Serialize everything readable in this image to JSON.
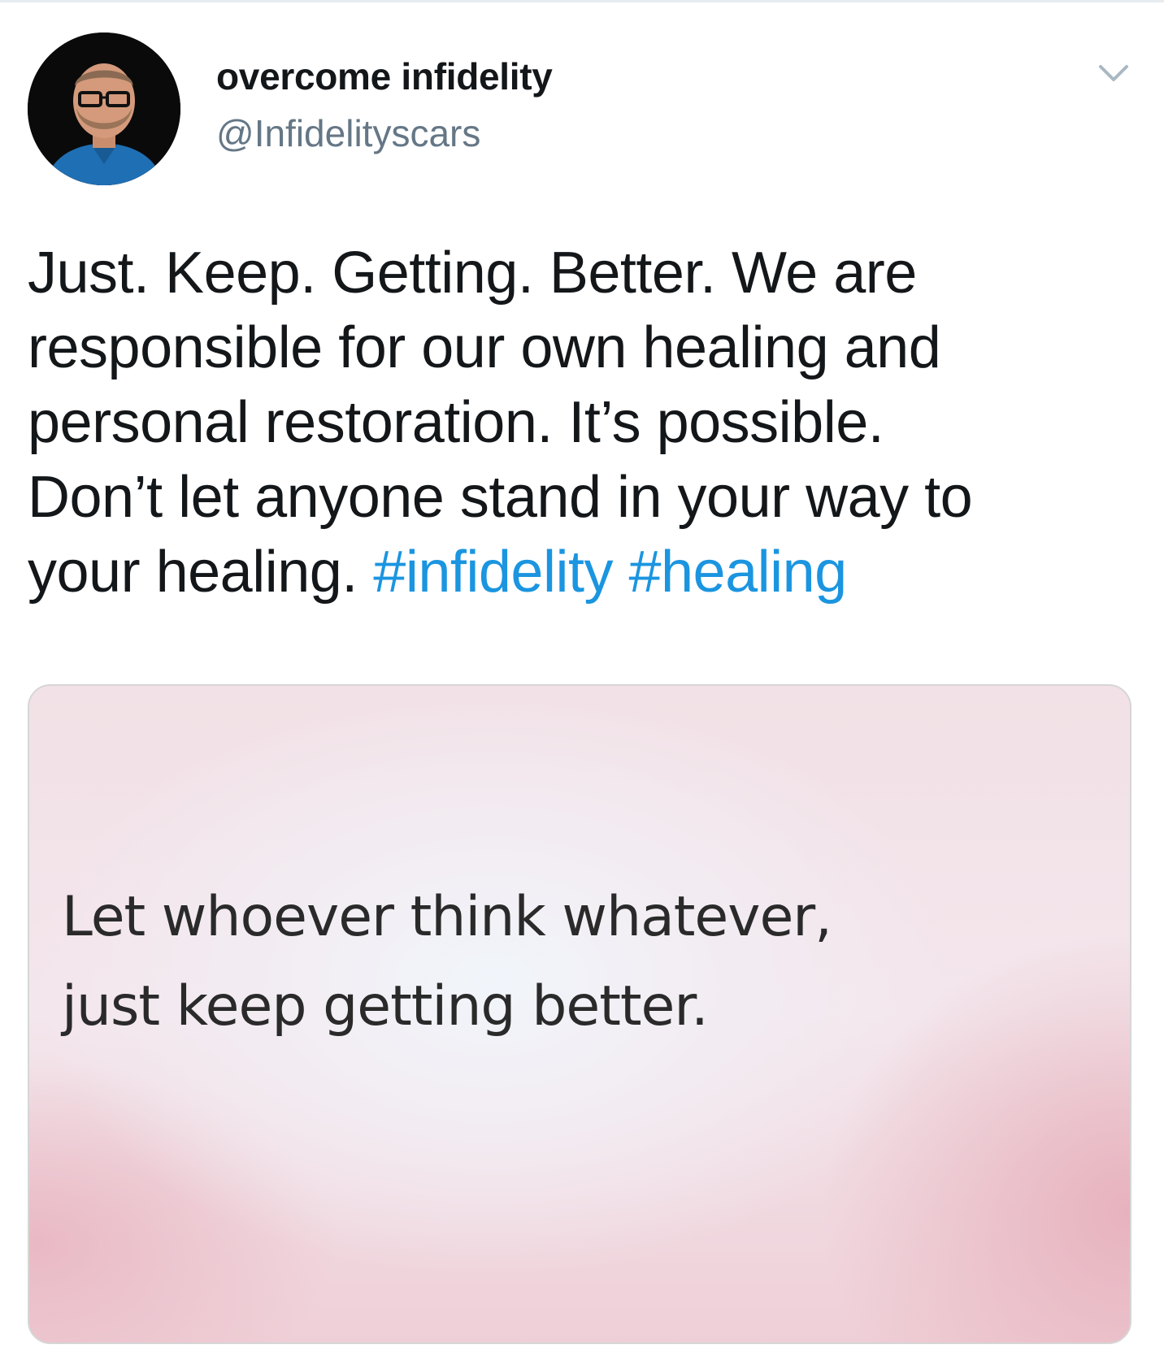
{
  "tweet": {
    "author": {
      "display_name": "overcome infidelity",
      "handle": "@Infidelityscars"
    },
    "menu_icon": "chevron-down-icon",
    "text_lines": [
      "Just. Keep. Getting. Better. We are",
      "responsible for our own healing and",
      "personal restoration. It’s possible.",
      "Don’t let anyone stand in your way to",
      "your healing. "
    ],
    "hashtags": [
      "#infidelity",
      "#healing"
    ],
    "media": {
      "quote_lines": [
        "Let whoever think whatever,",
        "just keep getting better."
      ]
    }
  },
  "colors": {
    "text": "#14171a",
    "secondary": "#657786",
    "hashtag": "#1b95e0"
  }
}
